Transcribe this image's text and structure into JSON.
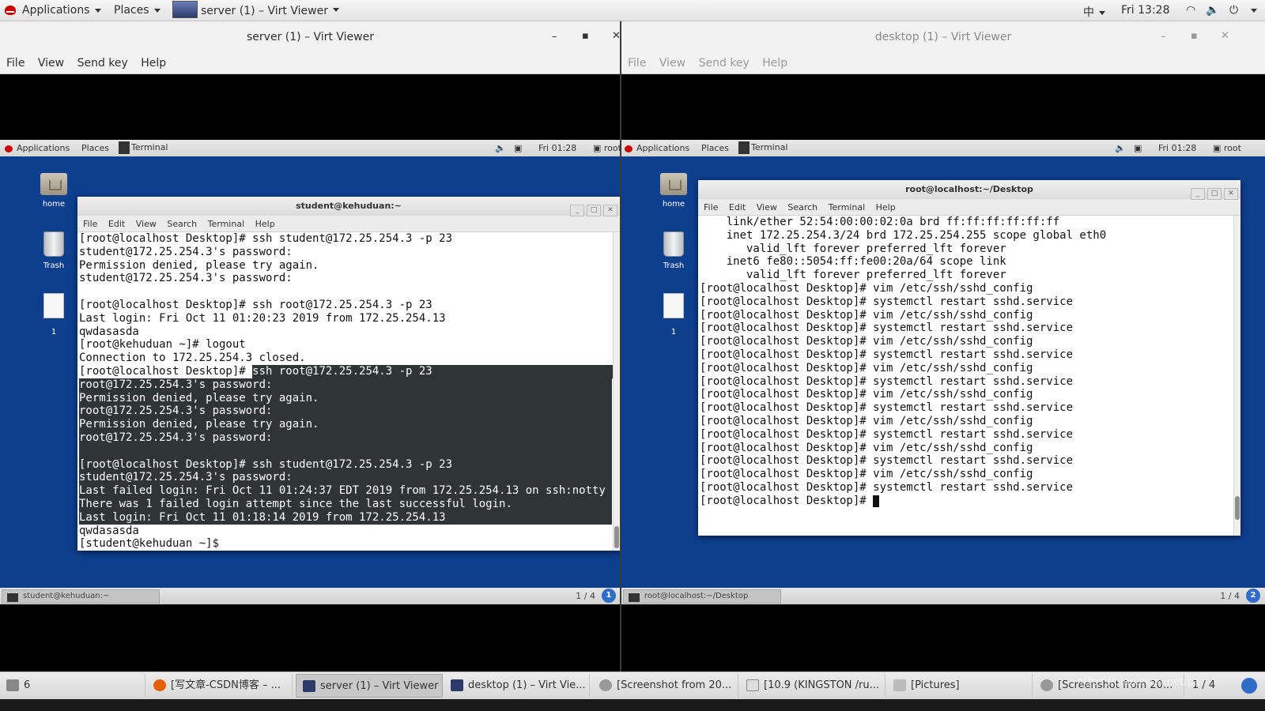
{
  "host": {
    "top_panel": {
      "applications": "Applications",
      "places": "Places",
      "active_window": "server (1) – Virt Viewer",
      "input_method": "中",
      "clock": "Fri 13:28"
    },
    "taskbar": {
      "workspace_num": "6",
      "items": [
        "[写文章-CSDN博客 – ...",
        "server (1) – Virt Viewer",
        "desktop (1) – Virt Vie...",
        "[Screenshot from 20...",
        "[10.9 (KINGSTON /ru...",
        "[Pictures]",
        "[Screenshot from 20..."
      ],
      "pager": "1 / 4",
      "watermark": "https://blog.csdn.net/pa..."
    }
  },
  "left_viewer": {
    "title": "server (1) – Virt Viewer",
    "menu": [
      "File",
      "View",
      "Send key",
      "Help"
    ],
    "guest": {
      "panel": {
        "applications": "Applications",
        "places": "Places",
        "window": "Terminal",
        "clock": "Fri 01:28",
        "user": "root"
      },
      "desktop_icons": [
        "home",
        "Trash",
        "1"
      ],
      "terminal": {
        "title": "student@kehuduan:~",
        "menu": [
          "File",
          "Edit",
          "View",
          "Search",
          "Terminal",
          "Help"
        ],
        "lines": [
          "[root@localhost Desktop]# ssh student@172.25.254.3 -p 23",
          "student@172.25.254.3's password:",
          "Permission denied, please try again.",
          "student@172.25.254.3's password:",
          "",
          "[root@localhost Desktop]# ssh root@172.25.254.3 -p 23",
          "Last login: Fri Oct 11 01:20:23 2019 from 172.25.254.13",
          "qwdasasda",
          "[root@kehuduan ~]# logout",
          "Connection to 172.25.254.3 closed.",
          "[root@localhost Desktop]# ssh root@172.25.254.3 -p 23",
          "root@172.25.254.3's password:",
          "Permission denied, please try again.",
          "root@172.25.254.3's password:",
          "Permission denied, please try again.",
          "root@172.25.254.3's password:",
          "",
          "[root@localhost Desktop]# ssh student@172.25.254.3 -p 23",
          "student@172.25.254.3's password:",
          "Last failed login: Fri Oct 11 01:24:37 EDT 2019 from 172.25.254.13 on ssh:notty",
          "There was 1 failed login attempt since the last successful login.",
          "Last login: Fri Oct 11 01:18:14 2019 from 172.25.254.13",
          "qwdasasda",
          "[student@kehuduan ~]$"
        ]
      },
      "taskbar_item": "student@kehuduan:~",
      "pager": "1 / 4",
      "notify": "1"
    }
  },
  "right_viewer": {
    "title": "desktop (1) – Virt Viewer",
    "menu": [
      "File",
      "View",
      "Send key",
      "Help"
    ],
    "guest": {
      "panel": {
        "applications": "Applications",
        "places": "Places",
        "window": "Terminal",
        "clock": "Fri 01:28",
        "user": "root"
      },
      "desktop_icons": [
        "home",
        "Trash",
        "1"
      ],
      "terminal": {
        "title": "root@localhost:~/Desktop",
        "menu": [
          "File",
          "Edit",
          "View",
          "Search",
          "Terminal",
          "Help"
        ],
        "lines": [
          "    link/ether 52:54:00:00:02:0a brd ff:ff:ff:ff:ff:ff",
          "    inet 172.25.254.3/24 brd 172.25.254.255 scope global eth0",
          "       valid_lft forever preferred_lft forever",
          "    inet6 fe80::5054:ff:fe00:20a/64 scope link",
          "       valid_lft forever preferred_lft forever",
          "[root@localhost Desktop]# vim /etc/ssh/sshd_config",
          "[root@localhost Desktop]# systemctl restart sshd.service",
          "[root@localhost Desktop]# vim /etc/ssh/sshd_config",
          "[root@localhost Desktop]# systemctl restart sshd.service",
          "[root@localhost Desktop]# vim /etc/ssh/sshd_config",
          "[root@localhost Desktop]# systemctl restart sshd.service",
          "[root@localhost Desktop]# vim /etc/ssh/sshd_config",
          "[root@localhost Desktop]# systemctl restart sshd.service",
          "[root@localhost Desktop]# vim /etc/ssh/sshd_config",
          "[root@localhost Desktop]# systemctl restart sshd.service",
          "[root@localhost Desktop]# vim /etc/ssh/sshd_config",
          "[root@localhost Desktop]# systemctl restart sshd.service",
          "[root@localhost Desktop]# vim /etc/ssh/sshd_config",
          "[root@localhost Desktop]# systemctl restart sshd.service",
          "[root@localhost Desktop]# vim /etc/ssh/sshd_config",
          "[root@localhost Desktop]# systemctl restart sshd.service",
          "[root@localhost Desktop]# "
        ]
      },
      "taskbar_item": "root@localhost:~/Desktop",
      "pager": "1 / 4",
      "notify": "2"
    }
  }
}
